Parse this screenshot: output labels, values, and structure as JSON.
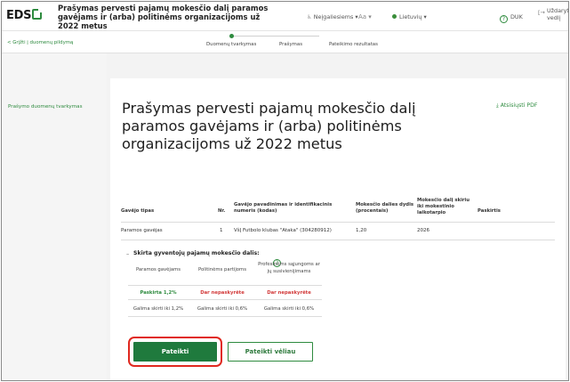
{
  "header": {
    "logo": "EDS",
    "title": "Prašymas pervesti pajamų mokesčio dalį paramos gavėjams ir (arba) politinėms organizacijoms už 2022 metus",
    "disability_label": "Neįgaliesiems ▾",
    "font_label": "Aa ▾",
    "language_label": "Lietuvių ▾",
    "help_label": "DUK",
    "close_label": "Uždaryti vedlį"
  },
  "stepper": {
    "back_label": "< Grįžti į duomenų pildymą",
    "steps": [
      "Duomenų tvarkymas",
      "Prašymas",
      "Pateikimo rezultatas"
    ],
    "active_step": 0
  },
  "sidebar": {
    "link_label": "Prašymo duomenų tvarkymas"
  },
  "main": {
    "title": "Prašymas pervesti pajamų mokesčio dalį paramos gavėjams ir (arba) politinėms organizacijoms už 2022 metus",
    "pdf_label": "Atsisiųsti PDF",
    "table": {
      "headers": [
        "Gavėjo tipas",
        "Nr.",
        "Gavėjo pavadinimas ir identifikacinis numeris (kodas)",
        "Mokesčio dalies dydis (procentais)",
        "Mokesčio dalį skiriu iki mokestinio laikotarpio",
        "Paskirtis"
      ],
      "rows": [
        [
          "Paramos gavėjas",
          "1",
          "VšĮ Futbolo klubas \"Ataka\" (304280912)",
          "1,20",
          "2026",
          ""
        ]
      ]
    },
    "section_title": "Skirta gyventojų pajamų mokesčio dalis:",
    "subtable": {
      "headers": [
        "Paramos gavėjams",
        "Politinėms partijoms",
        "Profesinėms sąjungoms ar jų susivienijimams"
      ],
      "status": [
        "Paskirta 1,2%",
        "Dar nepaskyrėte",
        "Dar nepaskyrėte"
      ],
      "limits": [
        "Galima skirti iki 1,2%",
        "Galima skirti iki 0,6%",
        "Galima skirti iki 0,6%"
      ]
    },
    "buttons": {
      "submit": "Pateikti",
      "submit_later": "Pateikti vėliau"
    }
  },
  "colors": {
    "brand_green": "#1f7a3d",
    "link_green": "#2e8b3f",
    "warning_red": "#d23a3a",
    "highlight_red": "#e0281f"
  }
}
